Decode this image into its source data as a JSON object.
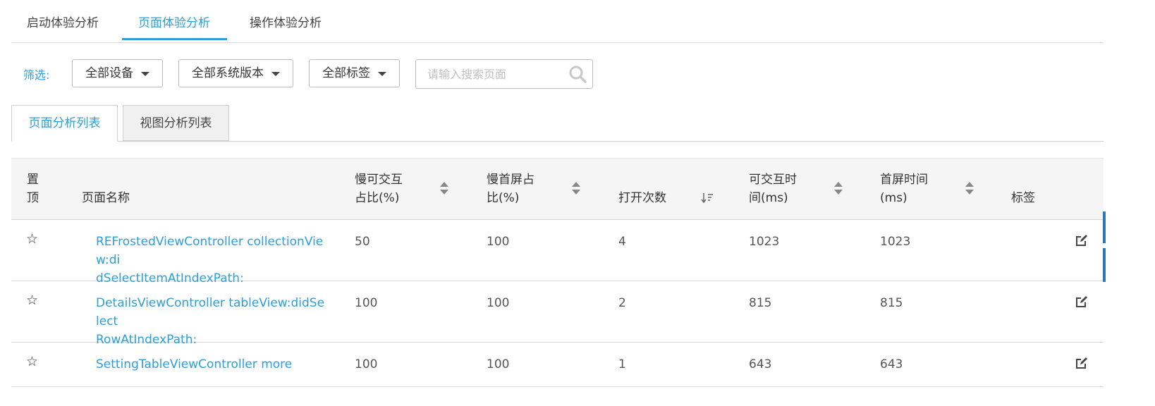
{
  "top_tabs": [
    {
      "label": "启动体验分析",
      "active": false
    },
    {
      "label": "页面体验分析",
      "active": true
    },
    {
      "label": "操作体验分析",
      "active": false
    }
  ],
  "filters": {
    "label": "筛选:",
    "device": "全部设备",
    "os_version": "全部系统版本",
    "tag": "全部标签",
    "search_placeholder": "请输入搜索页面",
    "search_value": ""
  },
  "sub_tabs": [
    {
      "label": "页面分析列表",
      "active": true
    },
    {
      "label": "视图分析列表",
      "active": false
    }
  ],
  "table": {
    "headers": {
      "pin_line1": "置",
      "pin_line2": "顶",
      "name": "页面名称",
      "slow_interact_line1": "慢可交互",
      "slow_interact_line2": "占比(%)",
      "slow_firstscreen_line1": "慢首屏占",
      "slow_firstscreen_line2": "比(%)",
      "open_count": "打开次数",
      "interact_time_line1": "可交互时",
      "interact_time_line2": "间(ms)",
      "firstscreen_time_line1": "首屏时间",
      "firstscreen_time_line2": "(ms)",
      "tag": "标签"
    },
    "rows": [
      {
        "name_line1": "REFrostedViewController collectionView:di",
        "name_line2": "dSelectItemAtIndexPath:",
        "slow_interact": "50",
        "slow_firstscreen": "100",
        "open_count": "4",
        "interact_time": "1023",
        "firstscreen_time": "1023"
      },
      {
        "name_line1": "DetailsViewController tableView:didSelect",
        "name_line2": "RowAtIndexPath:",
        "slow_interact": "100",
        "slow_firstscreen": "100",
        "open_count": "2",
        "interact_time": "815",
        "firstscreen_time": "815"
      },
      {
        "name_line1": "SettingTableViewController more",
        "name_line2": "",
        "slow_interact": "100",
        "slow_firstscreen": "100",
        "open_count": "1",
        "interact_time": "643",
        "firstscreen_time": "643"
      }
    ]
  },
  "icons": {
    "star": "☆",
    "search": "search-icon",
    "edit": "edit-icon",
    "sort": "sort-icon",
    "sort_desc": "sort-desc-icon"
  },
  "colors": {
    "accent": "#2b9fdb",
    "text": "#333333",
    "header_bg": "#f5f5f5",
    "border": "#d9d9d9"
  }
}
